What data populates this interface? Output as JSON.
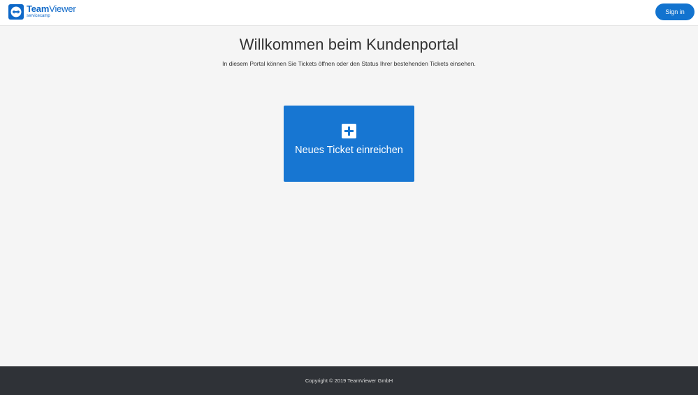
{
  "header": {
    "logo": {
      "brand_bold": "Team",
      "brand_regular": "Viewer",
      "product": "servicecamp",
      "icon": "teamviewer-logo-icon"
    },
    "signin_label": "Sign in"
  },
  "main": {
    "title": "Willkommen beim Kundenportal",
    "subtitle": "In diesem Portal können Sie Tickets öffnen oder den Status Ihrer bestehenden Tickets einsehen.",
    "tile": {
      "icon": "plus-square-icon",
      "label": "Neues Ticket einreichen"
    }
  },
  "footer": {
    "copyright": "Copyright © 2019 TeamViewer GmbH"
  },
  "colors": {
    "brand_blue": "#0e68c8",
    "button_blue": "#1273cf",
    "tile_blue": "#1776d2",
    "footer_bg": "#2f3237",
    "page_bg": "#f5f5f5"
  }
}
